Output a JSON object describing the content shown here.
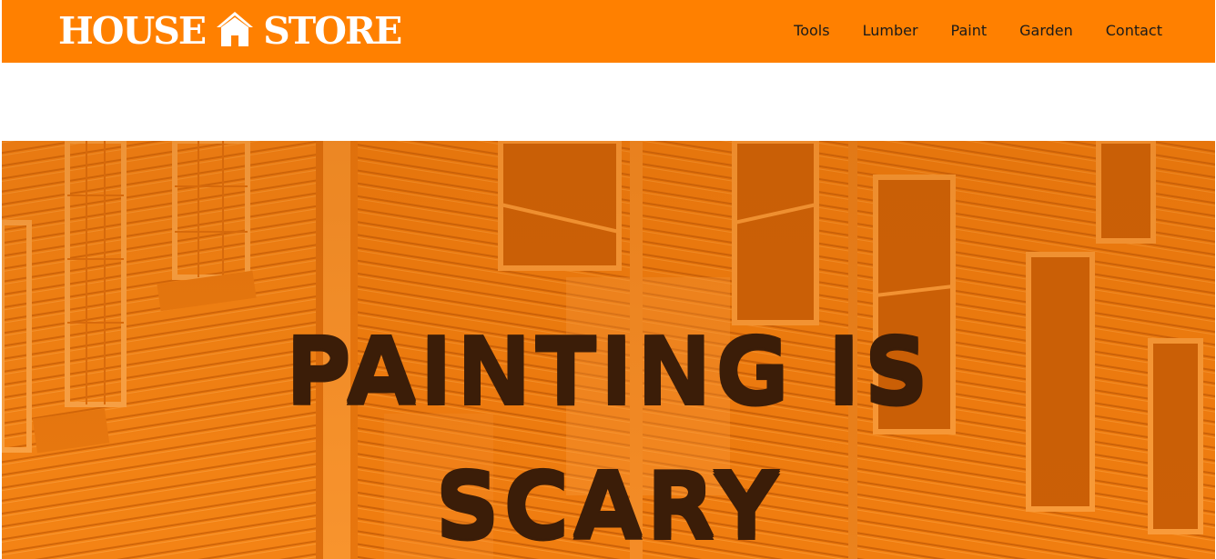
{
  "header": {
    "logo": {
      "word1": "HOUSE",
      "word2": "STORE",
      "icon": "house-icon"
    },
    "nav": [
      {
        "label": "Tools"
      },
      {
        "label": "Lumber"
      },
      {
        "label": "Paint"
      },
      {
        "label": "Garden"
      },
      {
        "label": "Contact"
      }
    ]
  },
  "hero": {
    "line1": "PAINTING IS",
    "line2": "SCARY",
    "background": "wooden-house-photo"
  },
  "colors": {
    "brand": "#ff8000",
    "hero_tint": "#f07e14",
    "hero_text": "#3b1d08",
    "nav_text": "#1a1a1a"
  }
}
